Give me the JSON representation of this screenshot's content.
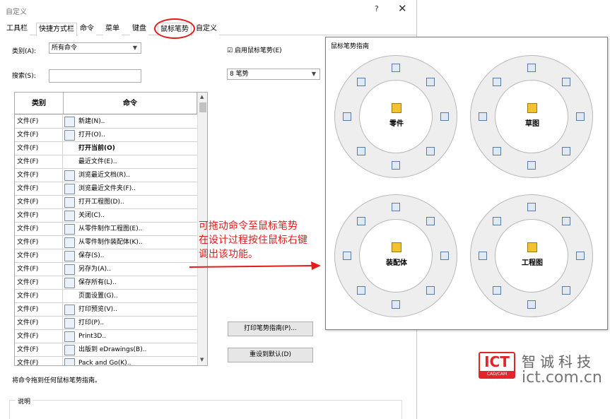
{
  "window": {
    "title": "自定义",
    "help": "?",
    "close": "✕"
  },
  "tabs": [
    "工具栏",
    "快捷方式栏",
    "命令",
    "菜单",
    "键盘",
    "鼠标笔势",
    "自定义"
  ],
  "category": {
    "label": "类别(A):",
    "value": "所有命令"
  },
  "search": {
    "label": "搜索(S):",
    "value": ""
  },
  "enable": {
    "label": "启用鼠标笔势(E)",
    "checked": "☑"
  },
  "gesture_count": {
    "value": "8 笔势"
  },
  "table": {
    "headers": [
      "类别",
      "命令"
    ],
    "rows": [
      {
        "cat": "文件(F)",
        "cmd": "新建(N)..",
        "icon": "new-doc-icon"
      },
      {
        "cat": "文件(F)",
        "cmd": "打开(O)..",
        "icon": "open-icon"
      },
      {
        "cat": "文件(F)",
        "cmd": "打开当前(O)",
        "icon": "",
        "bold": true
      },
      {
        "cat": "文件(F)",
        "cmd": "最近文件(E)..",
        "icon": ""
      },
      {
        "cat": "文件(F)",
        "cmd": "浏览最近文档(R)..",
        "icon": "browse-doc-icon"
      },
      {
        "cat": "文件(F)",
        "cmd": "浏览最近文件夹(F)..",
        "icon": "browse-folder-icon"
      },
      {
        "cat": "文件(F)",
        "cmd": "打开工程图(D)..",
        "icon": "drawing-icon"
      },
      {
        "cat": "文件(F)",
        "cmd": "关闭(C)..",
        "icon": "close-doc-icon"
      },
      {
        "cat": "文件(F)",
        "cmd": "从零件制作工程图(E)..",
        "icon": "make-drawing-icon"
      },
      {
        "cat": "文件(F)",
        "cmd": "从零件制作装配体(K)..",
        "icon": "make-assembly-icon"
      },
      {
        "cat": "文件(F)",
        "cmd": "保存(S)..",
        "icon": "save-icon"
      },
      {
        "cat": "文件(F)",
        "cmd": "另存为(A)..",
        "icon": "save-as-icon"
      },
      {
        "cat": "文件(F)",
        "cmd": "保存所有(L)..",
        "icon": "save-all-icon"
      },
      {
        "cat": "文件(F)",
        "cmd": "页面设置(G)..",
        "icon": ""
      },
      {
        "cat": "文件(F)",
        "cmd": "打印预览(V)..",
        "icon": "print-preview-icon"
      },
      {
        "cat": "文件(F)",
        "cmd": "打印(P)..",
        "icon": "print-icon"
      },
      {
        "cat": "文件(F)",
        "cmd": "Print3D..",
        "icon": "print3d-icon"
      },
      {
        "cat": "文件(F)",
        "cmd": "出版到 eDrawings(B)..",
        "icon": "edrawings-icon"
      },
      {
        "cat": "文件(F)",
        "cmd": "Pack and Go(K)..",
        "icon": "pack-icon"
      }
    ]
  },
  "buttons": {
    "print_guide": "打印笔势指南(P)...",
    "reset": "重设到默认(D)"
  },
  "hint": "将命令拖到任何鼠标笔势指南。",
  "desc_label": "说明",
  "annotation": [
    "可拖动命令至鼠标笔势",
    "在设计过程按住鼠标右键",
    "调出该功能。"
  ],
  "panel": {
    "title": "鼠标笔势指南",
    "wheels": [
      "零件",
      "草图",
      "装配体",
      "工程图"
    ]
  },
  "logo": {
    "ict": "ICT",
    "sub": "CAD/CAM",
    "cn": "智诚科技",
    "url": "ict.com.cn"
  }
}
